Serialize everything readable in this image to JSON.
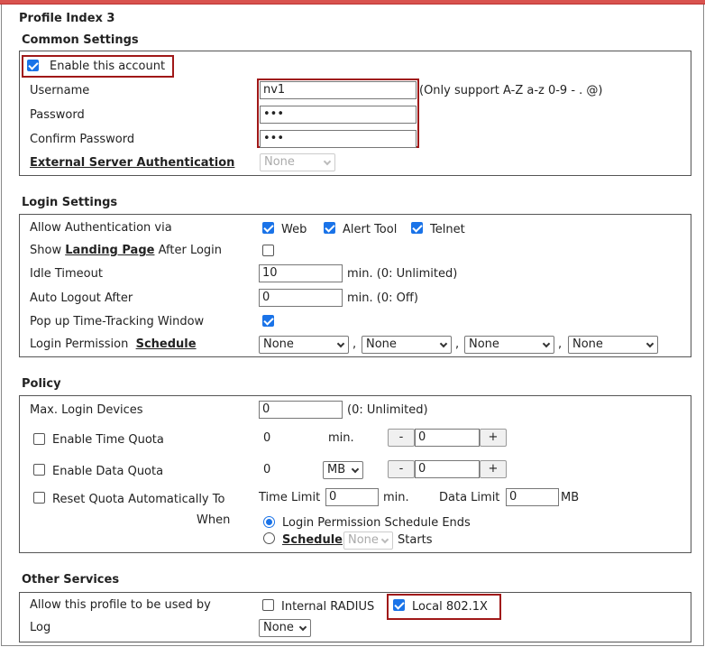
{
  "profile_title": "Profile Index 3",
  "common": {
    "heading": "Common Settings",
    "enable_label": "Enable this account",
    "enable_checked": true,
    "username_label": "Username",
    "username_value": "nv1",
    "username_hint": "(Only support A-Z a-z 0-9 - . @)",
    "password_label": "Password",
    "password_value": "•••",
    "confirm_label": "Confirm Password",
    "confirm_value": "•••",
    "ext_auth_label": "External Server Authentication",
    "ext_auth_value": "None"
  },
  "login": {
    "heading": "Login Settings",
    "allow_auth_label": "Allow Authentication via",
    "auth_web": "Web",
    "auth_alert": "Alert Tool",
    "auth_telnet": "Telnet",
    "show_prefix": "Show",
    "landing_link": "Landing Page",
    "show_suffix": "After Login",
    "idle_label": "Idle Timeout",
    "idle_value": "10",
    "idle_hint": "min. (0: Unlimited)",
    "auto_logout_label": "Auto Logout After",
    "auto_logout_value": "0",
    "auto_logout_hint": "min. (0: Off)",
    "popup_label": "Pop up Time-Tracking Window",
    "permission_label": "Login Permission",
    "schedule_link": "Schedule",
    "schedules": [
      "None",
      "None",
      "None",
      "None"
    ],
    "sep": ","
  },
  "policy": {
    "heading": "Policy",
    "max_devices_label": "Max. Login Devices",
    "max_devices_value": "0",
    "max_devices_hint": "(0: Unlimited)",
    "time_quota_label": "Enable Time Quota",
    "time_quota_value": "0",
    "time_unit": "min.",
    "time_step_value": "0",
    "data_quota_label": "Enable Data Quota",
    "data_quota_value": "0",
    "data_unit": "MB",
    "data_step_value": "0",
    "minus": "-",
    "plus": "+",
    "reset_label": "Reset Quota Automatically To",
    "reset_when": "When",
    "time_limit_label": "Time Limit",
    "time_limit_value": "0",
    "time_limit_unit": "min.",
    "data_limit_label": "Data Limit",
    "data_limit_value": "0",
    "data_limit_unit": "MB",
    "opt_schedule_ends": "Login Permission Schedule Ends",
    "opt_schedule_link": "Schedule",
    "opt_schedule_value": "None",
    "opt_starts": "Starts"
  },
  "other": {
    "heading": "Other Services",
    "allow_profile_label": "Allow this profile to be used by",
    "internal_radius": "Internal RADIUS",
    "local_8021x": "Local 802.1X",
    "log_label": "Log",
    "log_value": "None"
  },
  "colors": {
    "accent": "#1a73e8",
    "highlight": "#a01818",
    "topbar": "#d9534f"
  }
}
